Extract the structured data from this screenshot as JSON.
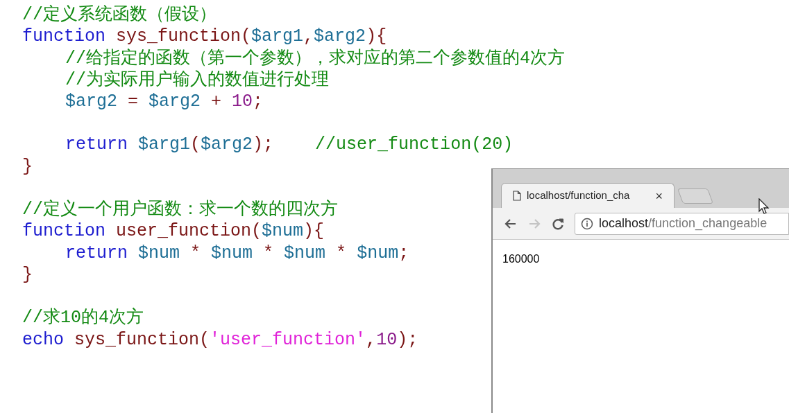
{
  "code": {
    "blocks": [
      {
        "lines": [
          {
            "indented": false,
            "tokens": [
              {
                "kind": "comment",
                "text": "//定义系统函数（假设）"
              }
            ]
          },
          {
            "indented": false,
            "tokens": [
              {
                "kind": "keyword",
                "text": "function "
              },
              {
                "kind": "name",
                "text": "sys_function"
              },
              {
                "kind": "punct",
                "text": "("
              },
              {
                "kind": "var",
                "text": "$arg1"
              },
              {
                "kind": "punct",
                "text": ","
              },
              {
                "kind": "var",
                "text": "$arg2"
              },
              {
                "kind": "punct",
                "text": "){"
              }
            ]
          },
          {
            "indented": true,
            "tokens": [
              {
                "kind": "comment",
                "text": "//给指定的函数（第一个参数），求对应的第二个参数值的4次方"
              }
            ]
          },
          {
            "indented": true,
            "tokens": [
              {
                "kind": "comment",
                "text": "//为实际用户输入的数值进行处理"
              }
            ]
          },
          {
            "indented": true,
            "tokens": [
              {
                "kind": "var",
                "text": "$arg2"
              },
              {
                "kind": "punct",
                "text": " = "
              },
              {
                "kind": "var",
                "text": "$arg2"
              },
              {
                "kind": "punct",
                "text": " + "
              },
              {
                "kind": "number",
                "text": "10"
              },
              {
                "kind": "punct",
                "text": ";"
              }
            ]
          }
        ]
      },
      {
        "lines": [
          {
            "indented": true,
            "tokens": [
              {
                "kind": "keyword",
                "text": "return "
              },
              {
                "kind": "var",
                "text": "$arg1"
              },
              {
                "kind": "punct",
                "text": "("
              },
              {
                "kind": "var",
                "text": "$arg2"
              },
              {
                "kind": "punct",
                "text": ");    "
              },
              {
                "kind": "comment",
                "text": "//user_function(20)"
              }
            ]
          },
          {
            "indented": false,
            "tokens": [
              {
                "kind": "punct",
                "text": "}"
              }
            ]
          }
        ]
      },
      {
        "lines": [
          {
            "indented": false,
            "tokens": [
              {
                "kind": "comment",
                "text": "//定义一个用户函数：求一个数的四次方"
              }
            ]
          },
          {
            "indented": false,
            "tokens": [
              {
                "kind": "keyword",
                "text": "function "
              },
              {
                "kind": "name",
                "text": "user_function"
              },
              {
                "kind": "punct",
                "text": "("
              },
              {
                "kind": "var",
                "text": "$num"
              },
              {
                "kind": "punct",
                "text": "){"
              }
            ]
          },
          {
            "indented": true,
            "tokens": [
              {
                "kind": "keyword",
                "text": "return "
              },
              {
                "kind": "var",
                "text": "$num"
              },
              {
                "kind": "punct",
                "text": " * "
              },
              {
                "kind": "var",
                "text": "$num"
              },
              {
                "kind": "punct",
                "text": " * "
              },
              {
                "kind": "var",
                "text": "$num"
              },
              {
                "kind": "punct",
                "text": " * "
              },
              {
                "kind": "var",
                "text": "$num"
              },
              {
                "kind": "punct",
                "text": ";"
              }
            ]
          },
          {
            "indented": false,
            "tokens": [
              {
                "kind": "punct",
                "text": "}"
              }
            ]
          }
        ]
      },
      {
        "lines": [
          {
            "indented": false,
            "tokens": [
              {
                "kind": "comment",
                "text": "//求10的4次方"
              }
            ]
          },
          {
            "indented": false,
            "tokens": [
              {
                "kind": "keyword",
                "text": "echo "
              },
              {
                "kind": "name",
                "text": "sys_function"
              },
              {
                "kind": "punct",
                "text": "("
              },
              {
                "kind": "string",
                "text": "'user_function'"
              },
              {
                "kind": "punct",
                "text": ","
              },
              {
                "kind": "number",
                "text": "10"
              },
              {
                "kind": "punct",
                "text": ");"
              }
            ]
          }
        ]
      }
    ]
  },
  "browser": {
    "tabs": [
      {
        "title": "localhost/function_cha",
        "close": "×",
        "selected": true
      }
    ],
    "nav_buttons": [
      {
        "kind": "back",
        "disabled": false
      },
      {
        "kind": "forward",
        "disabled": true
      },
      {
        "kind": "reload",
        "disabled": false
      }
    ],
    "address": {
      "host": "localhost",
      "path": "/function_changeable"
    },
    "page_text": "160000"
  }
}
